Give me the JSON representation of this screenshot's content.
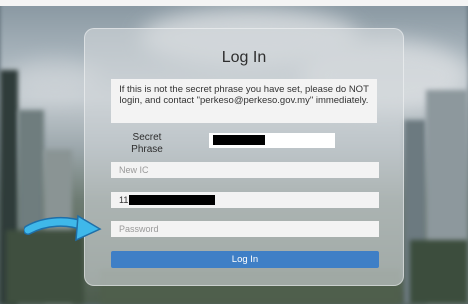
{
  "login": {
    "title": "Log In",
    "notice": "If this is not the secret phrase you have set, please do NOT login, and contact \"perkeso@perkeso.gov.my\" immediately.",
    "secret_phrase_label": "Secret Phrase",
    "new_ic_placeholder": "New IC",
    "ic_value": "11",
    "password_placeholder": "Password",
    "login_button": "Log In"
  },
  "colors": {
    "button_blue": "#3f7fc6",
    "arrow_blue": "#3fb8ea"
  },
  "icons": {
    "pointer": "arrow-pointer-icon"
  }
}
